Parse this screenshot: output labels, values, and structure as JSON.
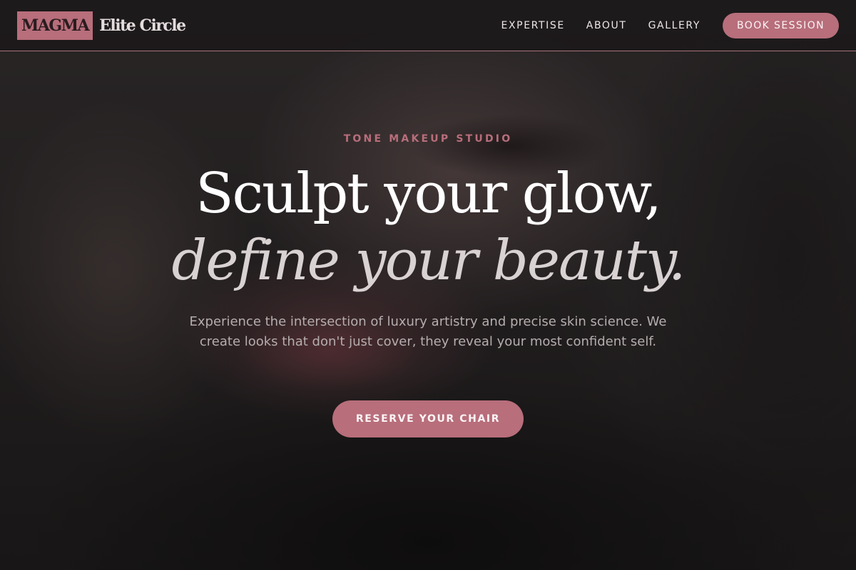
{
  "brand": {
    "box_label": "MAGMA",
    "name": "Elite Circle"
  },
  "nav": {
    "links": [
      "EXPERTISE",
      "ABOUT",
      "GALLERY"
    ],
    "cta_label": "BOOK SESSION"
  },
  "hero": {
    "eyebrow": "TONE MAKEUP STUDIO",
    "headline_line1": "Sculpt your glow,",
    "headline_line2": "define your beauty.",
    "subtext": "Experience the intersection of luxury artistry and precise skin science. We create looks that don't just cover, they reveal your most confident self.",
    "cta_label": "RESERVE YOUR CHAIR"
  },
  "colors": {
    "accent": "#b86e7b",
    "nav_background": "#1c191a",
    "text_light": "#ffffff",
    "text_muted": "#b5adae"
  }
}
